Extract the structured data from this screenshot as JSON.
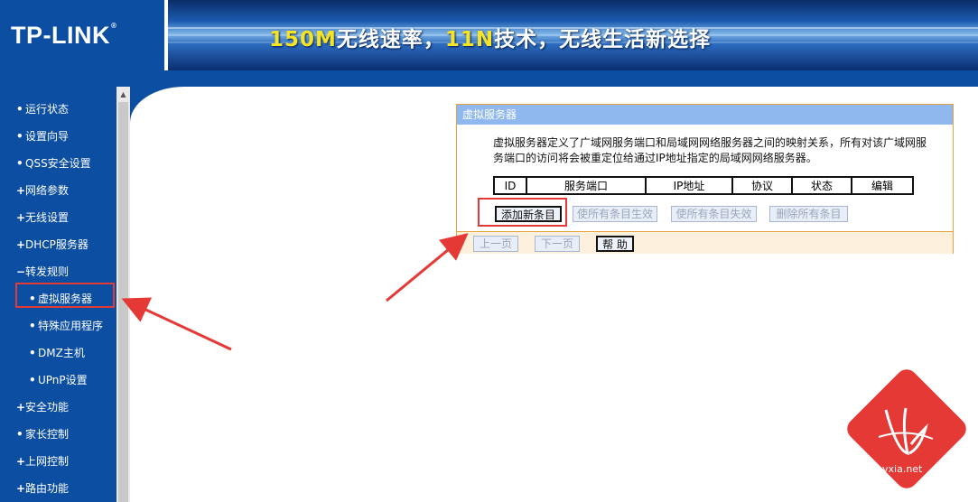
{
  "header": {
    "logo": "TP-LINK",
    "logo_mark": "®",
    "banner_part1": "150M",
    "banner_part2": "无线速率，",
    "banner_part3": "11N",
    "banner_part4": "技术，无线生活新选择"
  },
  "sidebar": {
    "items": [
      {
        "label": "运行状态",
        "bullet": "•"
      },
      {
        "label": "设置向导",
        "bullet": "•"
      },
      {
        "label": "QSS安全设置",
        "bullet": "•"
      },
      {
        "label": "网络参数",
        "bullet": "+"
      },
      {
        "label": "无线设置",
        "bullet": "+"
      },
      {
        "label": "DHCP服务器",
        "bullet": "+"
      },
      {
        "label": "转发规则",
        "bullet": "−"
      },
      {
        "label": "虚拟服务器",
        "bullet": "•"
      },
      {
        "label": "特殊应用程序",
        "bullet": "•"
      },
      {
        "label": "DMZ主机",
        "bullet": "•"
      },
      {
        "label": "UPnP设置",
        "bullet": "•"
      },
      {
        "label": "安全功能",
        "bullet": "+"
      },
      {
        "label": "家长控制",
        "bullet": "•"
      },
      {
        "label": "上网控制",
        "bullet": "+"
      },
      {
        "label": "路由功能",
        "bullet": "+"
      }
    ]
  },
  "panel": {
    "title": "虚拟服务器",
    "description": "虚拟服务器定义了广域网服务端口和局域网网络服务器之间的映射关系，所有对该广域网服务端口的访问将会被重定位给通过IP地址指定的局域网网络服务器。",
    "table_headers": [
      "ID",
      "服务端口",
      "IP地址",
      "协议",
      "状态",
      "编辑"
    ],
    "buttons": {
      "add": "添加新条目",
      "enable_all": "使所有条目生效",
      "disable_all": "使所有条目失效",
      "delete_all": "删除所有条目"
    },
    "nav": {
      "prev": "上一页",
      "next": "下一页",
      "help": "帮 助"
    }
  },
  "watermark": {
    "text": "vxia.net"
  },
  "colors": {
    "brand_blue": "#0b4ea2",
    "highlight_red": "#e53935",
    "banner_yellow": "#f5e326"
  }
}
